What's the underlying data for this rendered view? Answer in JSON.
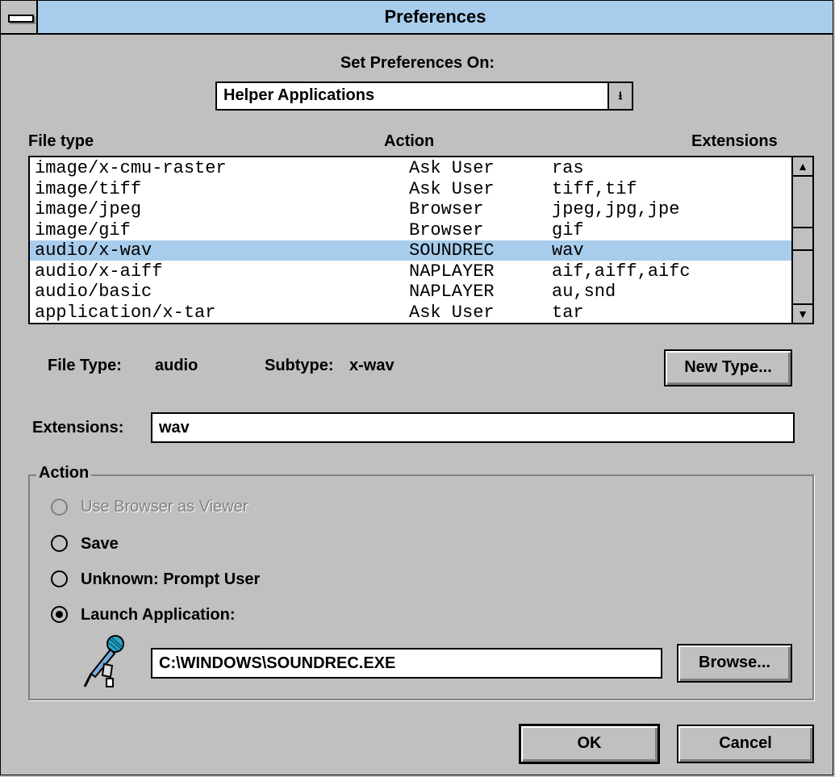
{
  "window": {
    "title": "Preferences"
  },
  "set_prefs": {
    "label": "Set Preferences On:",
    "selected": "Helper Applications"
  },
  "columns": {
    "file_type": "File type",
    "action": "Action",
    "extensions": "Extensions"
  },
  "rows": [
    {
      "type": "image/x-cmu-raster",
      "action": "Ask User",
      "ext": "ras"
    },
    {
      "type": "image/tiff",
      "action": "Ask User",
      "ext": "tiff,tif"
    },
    {
      "type": "image/jpeg",
      "action": "Browser",
      "ext": "jpeg,jpg,jpe"
    },
    {
      "type": "image/gif",
      "action": "Browser",
      "ext": "gif"
    },
    {
      "type": "audio/x-wav",
      "action": "SOUNDREC",
      "ext": "wav",
      "selected": true
    },
    {
      "type": "audio/x-aiff",
      "action": "NAPLAYER",
      "ext": "aif,aiff,aifc"
    },
    {
      "type": "audio/basic",
      "action": "NAPLAYER",
      "ext": "au,snd"
    },
    {
      "type": "application/x-tar",
      "action": "Ask User",
      "ext": "tar"
    }
  ],
  "details": {
    "file_type_label": "File Type:",
    "file_type_value": "audio",
    "subtype_label": "Subtype:",
    "subtype_value": "x-wav",
    "new_type_button": "New Type...",
    "extensions_label": "Extensions:",
    "extensions_value": "wav"
  },
  "action_group": {
    "legend": "Action",
    "options": [
      {
        "label": "Use Browser as Viewer",
        "checked": false,
        "disabled": true
      },
      {
        "label": "Save",
        "checked": false,
        "disabled": false
      },
      {
        "label": "Unknown:  Prompt User",
        "checked": false,
        "disabled": false
      },
      {
        "label": "Launch Application:",
        "checked": true,
        "disabled": false
      }
    ],
    "app_path": "C:\\WINDOWS\\SOUNDREC.EXE",
    "browse_button": "Browse..."
  },
  "footer": {
    "ok": "OK",
    "cancel": "Cancel"
  },
  "icons": {
    "system_menu": "system-menu-icon",
    "app": "microphone-icon"
  },
  "colors": {
    "selection": "#a8ccec",
    "titlebar": "#a8ccec",
    "face": "#c0c0c0"
  }
}
